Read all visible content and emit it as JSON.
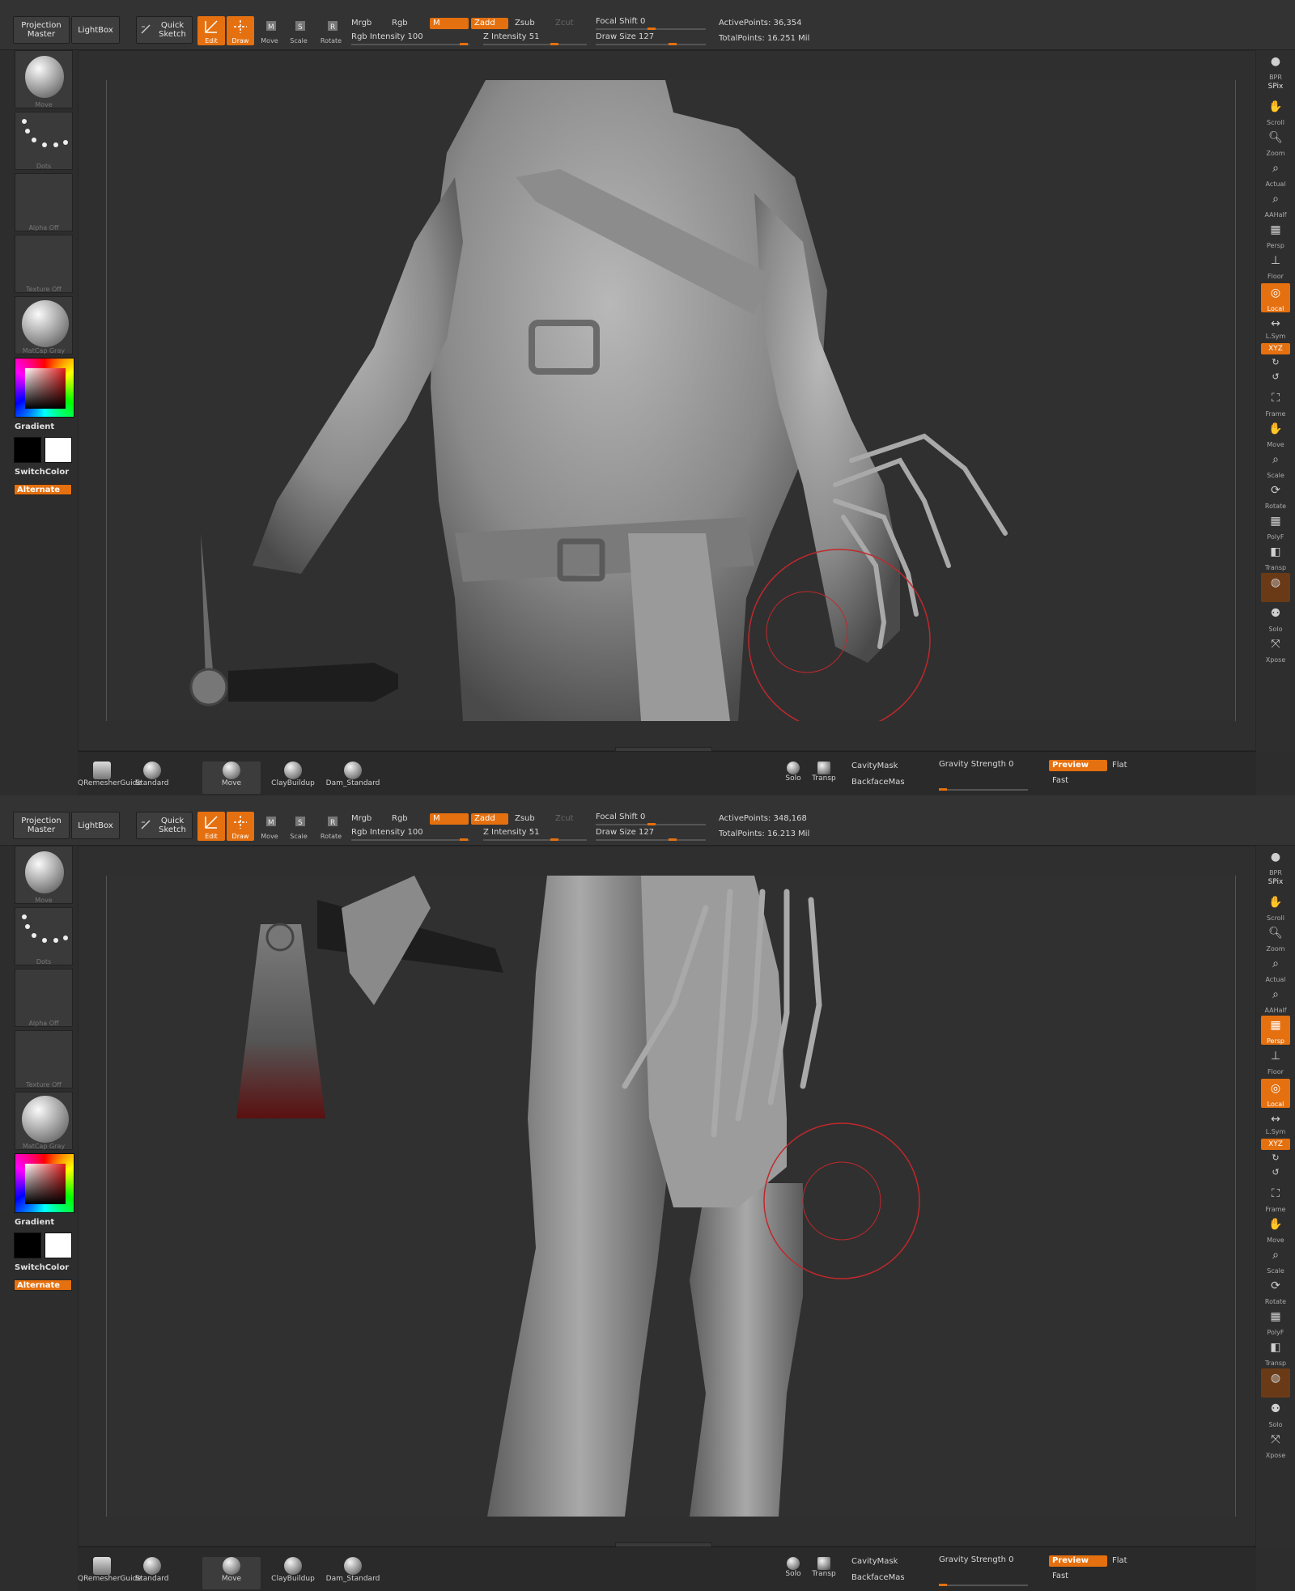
{
  "panes": [
    {
      "id": "top",
      "toolbar": {
        "projection_master": "Projection Master",
        "lightbox": "LightBox",
        "quick_sketch": "Quick Sketch",
        "edit": "Edit",
        "draw": "Draw",
        "move": "Move",
        "scale": "Scale",
        "rotate": "Rotate",
        "mrgb": "Mrgb",
        "rgb": "Rgb",
        "m": "M",
        "zadd": "Zadd",
        "zsub": "Zsub",
        "zcut": "Zcut",
        "rgb_intensity": "Rgb Intensity 100",
        "z_intensity": "Z Intensity 51",
        "focal_shift": "Focal Shift 0",
        "draw_size": "Draw Size 127",
        "active_points": "ActivePoints: 36,354",
        "total_points": "TotalPoints: 16.251 Mil"
      },
      "left": {
        "move": "Move",
        "dots": "Dots",
        "alpha": "Alpha Off",
        "texture": "Texture Off",
        "matcap": "MatCap Gray",
        "gradient": "Gradient",
        "switchcolor": "SwitchColor",
        "alternate": "Alternate"
      },
      "right": {
        "bpr": "BPR",
        "spix": "SPix",
        "scroll": "Scroll",
        "zoom": "Zoom",
        "actual": "Actual",
        "aahalf": "AAHalf",
        "persp": "Persp",
        "floor": "Floor",
        "local": "Local",
        "lsym": "L.Sym",
        "xyz": "XYZ",
        "frame": "Frame",
        "move": "Move",
        "scale": "Scale",
        "rotate": "Rotate",
        "polyf": "PolyF",
        "transp": "Transp",
        "solo": "Solo",
        "xpose": "Xpose"
      },
      "bottom": {
        "b1": "QRemesherGuide",
        "b2": "Standard",
        "b3": "Move",
        "b4": "ClayBuildup",
        "b5": "Dam_Standard",
        "solo": "Solo",
        "transp": "Transp",
        "cavity": "CavityMask",
        "backface": "BackfaceMas",
        "gravity": "Gravity Strength 0",
        "preview": "Preview",
        "flat": "Flat",
        "fast": "Fast"
      }
    },
    {
      "id": "bottom",
      "toolbar": {
        "projection_master": "Projection Master",
        "lightbox": "LightBox",
        "quick_sketch": "Quick Sketch",
        "edit": "Edit",
        "draw": "Draw",
        "move": "Move",
        "scale": "Scale",
        "rotate": "Rotate",
        "mrgb": "Mrgb",
        "rgb": "Rgb",
        "m": "M",
        "zadd": "Zadd",
        "zsub": "Zsub",
        "zcut": "Zcut",
        "rgb_intensity": "Rgb Intensity 100",
        "z_intensity": "Z Intensity 51",
        "focal_shift": "Focal Shift 0",
        "draw_size": "Draw Size 127",
        "active_points": "ActivePoints: 348,168",
        "total_points": "TotalPoints: 16.213 Mil"
      },
      "left": {
        "move": "Move",
        "dots": "Dots",
        "alpha": "Alpha Off",
        "texture": "Texture Off",
        "matcap": "MatCap Gray",
        "gradient": "Gradient",
        "switchcolor": "SwitchColor",
        "alternate": "Alternate"
      },
      "right": {
        "bpr": "BPR",
        "spix": "SPix",
        "scroll": "Scroll",
        "zoom": "Zoom",
        "actual": "Actual",
        "aahalf": "AAHalf",
        "persp": "Persp",
        "floor": "Floor",
        "local": "Local",
        "lsym": "L.Sym",
        "xyz": "XYZ",
        "frame": "Frame",
        "move": "Move",
        "scale": "Scale",
        "rotate": "Rotate",
        "polyf": "PolyF",
        "transp": "Transp",
        "solo": "Solo",
        "xpose": "Xpose"
      },
      "bottom": {
        "b1": "QRemesherGuide",
        "b2": "Standard",
        "b3": "Move",
        "b4": "ClayBuildup",
        "b5": "Dam_Standard",
        "solo": "Solo",
        "transp": "Transp",
        "cavity": "CavityMask",
        "backface": "BackfaceMas",
        "gravity": "Gravity Strength 0",
        "preview": "Preview",
        "flat": "Flat",
        "fast": "Fast"
      }
    }
  ],
  "state": {
    "top": {
      "persp_active": false
    },
    "bottom": {
      "persp_active": true
    }
  },
  "colors": {
    "accent": "#e5700f",
    "brush_ring": "#c0282c",
    "panel": "#333333",
    "canvas": "#303030"
  },
  "icons": {
    "brush_preview": "sphere-brush-icon",
    "stroke": "dots-stroke-icon",
    "material": "matcap-sphere-icon",
    "cursor": "brush-circle-icon"
  }
}
